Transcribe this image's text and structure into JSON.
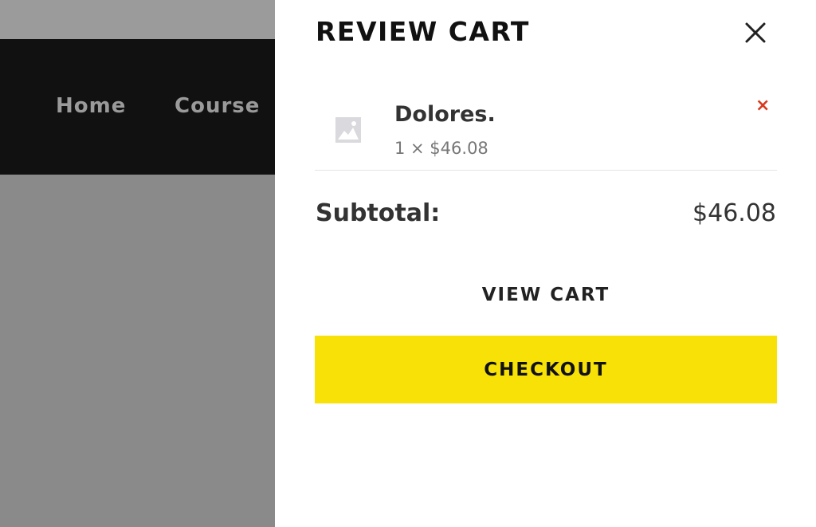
{
  "background_page": {
    "nav": {
      "items": [
        {
          "label": "Home"
        },
        {
          "label": "Course"
        }
      ]
    }
  },
  "cart_drawer": {
    "title": "REVIEW CART",
    "close_icon": "close-icon",
    "items": [
      {
        "name": "Dolores.",
        "quantity_price": "1 × $46.08",
        "thumbnail_icon": "image-placeholder-icon",
        "remove_label": "×"
      }
    ],
    "subtotal": {
      "label": "Subtotal:",
      "value": "$46.08"
    },
    "view_cart_label": "VIEW CART",
    "checkout_label": "CHECKOUT"
  },
  "colors": {
    "checkout_accent": "#f7e107",
    "remove_red": "#d9381e",
    "nav_background": "#111111",
    "overlay_gray": "#8a8a8a"
  }
}
